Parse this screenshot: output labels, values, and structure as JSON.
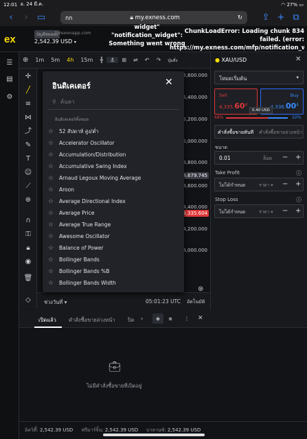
{
  "status": {
    "time": "12:01",
    "date": "อ. 24 มี.ค.",
    "battery": "27%"
  },
  "browser": {
    "aA": "กก",
    "url": "my.exness.com"
  },
  "header": {
    "logo": "ex",
    "account_badge": "บัญชีทดลอง",
    "server": "forexonapp.com",
    "balance": "2,542.39 USD",
    "error_left": "widget\" \"notification_widget\": Something went wrong",
    "error_right": "ChunkLoadError: Loading chunk 834 failed. (error: https://my.exness.com/mfp/notification_widget/834.js) [object Object]"
  },
  "chart_toolbar": {
    "tf1": "1m",
    "tf2": "5m",
    "tf3": "4h",
    "tf4": "15m",
    "more": "ปุ่มสั่ง"
  },
  "chart": {
    "prices": [
      "5,600.000",
      "5,400.000",
      "5,200.000",
      "5,000.000",
      "4,800.000",
      "4,600.000",
      "4,400.000",
      "4,200.000",
      "4,000.000"
    ],
    "label_ask": "4,679.745",
    "label_bid": "4,335.604",
    "range_label": "ช่วงวันที่",
    "time": "05:01:23 UTC",
    "auto": "อัตโนมัติ"
  },
  "indicators_modal": {
    "title": "อินดิเคเตอร์",
    "search_placeholder": "ค้นหา",
    "category": "อินดิเคเตอร์ทั้งหมด",
    "items": [
      "52 สัปดาห์ สูง/ต่ำ",
      "Accelerator Oscillator",
      "Accumulation/Distribution",
      "Accumulative Swing Index",
      "Arnaud Legoux Moving Average",
      "Aroon",
      "Average Directional Index",
      "Average Price",
      "Average True Range",
      "Awesome Oscillator",
      "Balance of Power",
      "Bollinger Bands",
      "Bollinger Bands %B",
      "Bollinger Bands Width"
    ]
  },
  "order_panel": {
    "symbol": "XAU/USD",
    "mode": "โหมดเริ่มต้น",
    "sell_label": "Sell",
    "sell_price_main": "4,335.",
    "sell_price_big": "60",
    "sell_price_sup": "4",
    "buy_label": "Buy",
    "buy_price_main": "4,336.",
    "buy_price_big": "00",
    "buy_price_sup": "4",
    "spread": "0.40 USD",
    "pct_sell": "68%",
    "pct_buy": "32%",
    "tab_market": "คำสั่งซื้อขายทันที",
    "tab_pending": "คำสั่งซื้อขายล่วงหน้า",
    "volume_label": "ขนาด",
    "volume_value": "0.01",
    "volume_unit": "ล็อต",
    "tp_label": "Take Profit",
    "tp_value": "ไม่ได้กำหนด",
    "tp_unit": "ราคา",
    "sl_label": "Stop Loss",
    "sl_value": "ไม่ได้กำหนด",
    "sl_unit": "ราคา"
  },
  "bottom": {
    "tab_open": "เปิดแล้ว",
    "tab_pending": "คำสั่งซื้อขายล่วงหน้า",
    "tab_closed": "ปิด",
    "empty": "ไม่มีคำสั่งซื้อขายที่เปิดอยู่"
  },
  "footer": {
    "equity_label": "อิควิตี้:",
    "equity": "2,542.39 USD",
    "free_margin_label": "ฟรีมาร์จิ้น:",
    "free_margin": "2,542.39 USD",
    "balance_label": "บาลานซ์:",
    "balance": "2,542.39 USD"
  }
}
